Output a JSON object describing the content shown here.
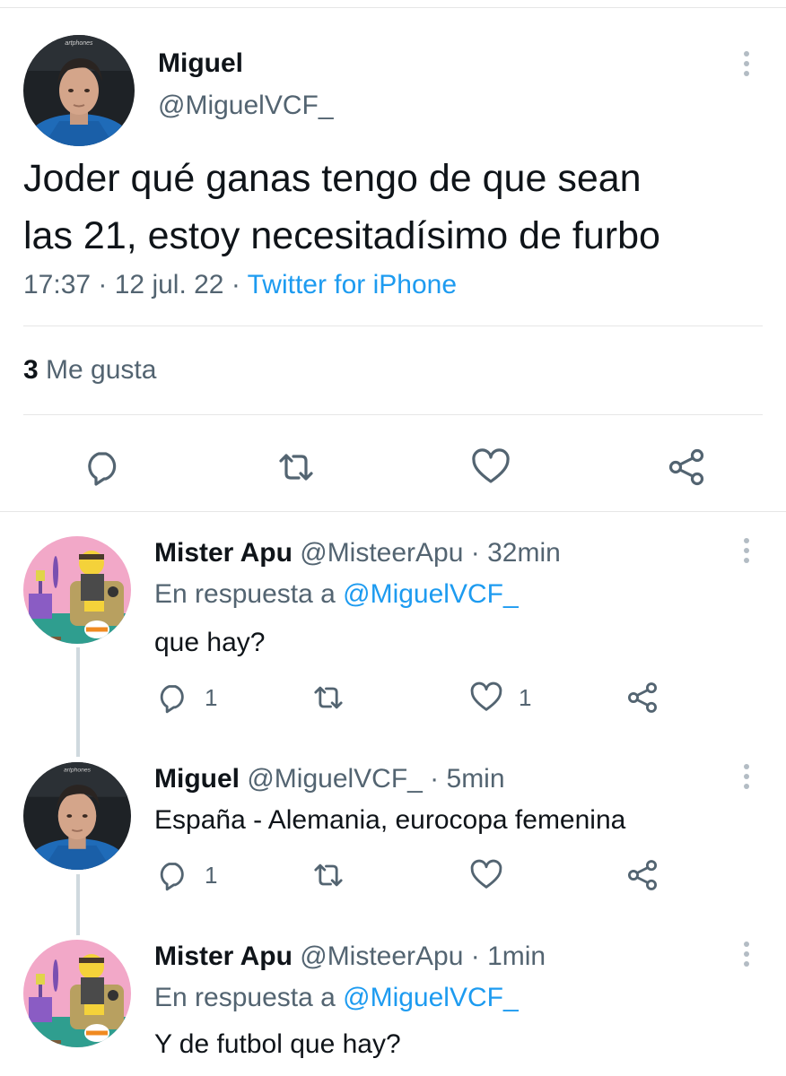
{
  "main_tweet": {
    "display_name": "Miguel",
    "handle": "@MiguelVCF_",
    "text_line1": "Joder qué ganas tengo de que sean",
    "text_line2": "las 21, estoy necesitadísimo de furbo",
    "timestamp": "17:37 · 12 jul. 22 · ",
    "source": "Twitter for iPhone",
    "likes_count": "3",
    "likes_label": " Me gusta",
    "avatar_watermark": "artphones",
    "actions": [
      "reply-icon",
      "retweet-icon",
      "like-icon",
      "share-icon"
    ]
  },
  "replies": [
    {
      "display_name": "Mister Apu",
      "handle_time": " @MisteerApu · 32min",
      "reply_to_prefix": "En respuesta a ",
      "reply_to": "@MiguelVCF_",
      "text": "que hay?",
      "reply_count": "1",
      "retweet_count": "",
      "like_count": "1"
    },
    {
      "display_name": "Miguel",
      "handle_time": " @MiguelVCF_ · 5min",
      "text": "España - Alemania, eurocopa femenina",
      "reply_count": "1",
      "retweet_count": "",
      "like_count": ""
    },
    {
      "display_name": "Mister Apu",
      "handle_time": " @MisteerApu · 1min",
      "reply_to_prefix": "En respuesta a ",
      "reply_to": "@MiguelVCF_",
      "text": "Y de futbol que hay?"
    }
  ],
  "colors": {
    "accent": "#1d9bf0",
    "secondary_text": "#536471",
    "primary_text": "#0f1419",
    "divider": "#e6e6e6",
    "thread_line": "#cfd9de"
  }
}
